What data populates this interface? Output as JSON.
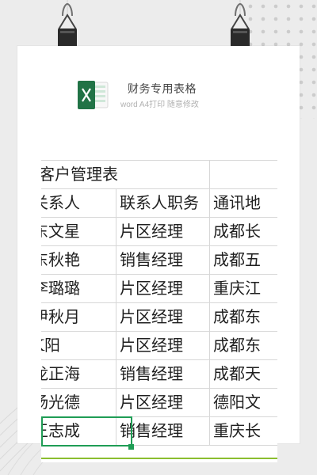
{
  "header": {
    "title": "财务专用表格",
    "subtitle": "word A4打印 随意修改"
  },
  "icons": {
    "file_type": "excel-icon",
    "binder_clip": "binder-clip-icon"
  },
  "sheet": {
    "title_row": {
      "label": "J客户管理表"
    },
    "headers": [
      "关系人",
      "联系人职务",
      "通讯地"
    ],
    "rows": [
      [
        "东文星",
        "片区经理",
        "成都长"
      ],
      [
        "东秋艳",
        "销售经理",
        "成都五"
      ],
      [
        "李璐璐",
        "片区经理",
        "重庆江"
      ],
      [
        "伊秋月",
        "片区经理",
        "成都东"
      ],
      [
        "K阳",
        "片区经理",
        "成都东"
      ],
      [
        "龙正海",
        "销售经理",
        "成都天"
      ],
      [
        "杨光德",
        "片区经理",
        "德阳文"
      ],
      [
        "王志成",
        "销售经理",
        "重庆长"
      ]
    ],
    "selected_cell": "王志成"
  },
  "colors": {
    "accent_green": "#24a25a",
    "selection_green": "#1f9d55",
    "lime_line": "#8bbd2f",
    "excel_green": "#217346"
  }
}
